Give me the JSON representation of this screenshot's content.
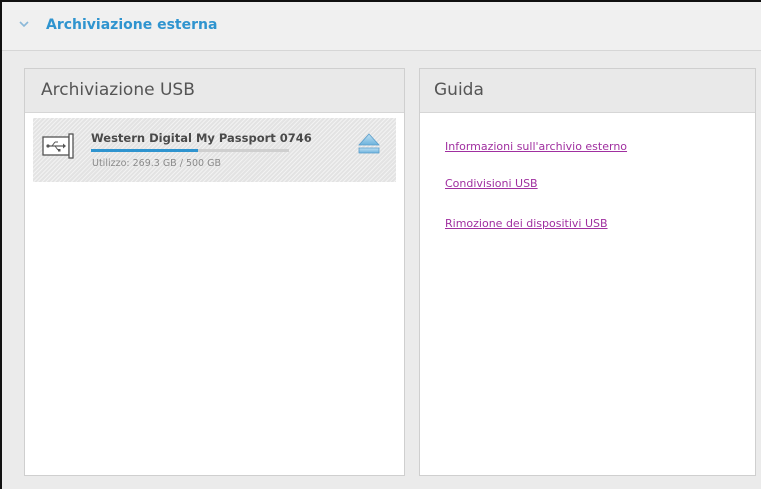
{
  "section": {
    "title": "Archiviazione esterna",
    "chevron_icon": "chevron-down-icon",
    "accent_color": "#2f94cf"
  },
  "usb_panel": {
    "title": "Archiviazione USB",
    "devices": [
      {
        "name": "Western Digital My Passport 0746",
        "usage_label": "Utilizzo: 269.3 GB / 500 GB",
        "used_gb": 269.3,
        "total_gb": 500,
        "usage_fraction": 0.5386,
        "icon": "usb-drive-icon",
        "eject_icon": "eject-icon"
      }
    ]
  },
  "guide_panel": {
    "title": "Guida",
    "links": [
      "Informazioni sull'archivio esterno",
      "Condivisioni USB",
      "Rimozione dei dispositivi USB"
    ],
    "link_color": "#a02fa0"
  }
}
